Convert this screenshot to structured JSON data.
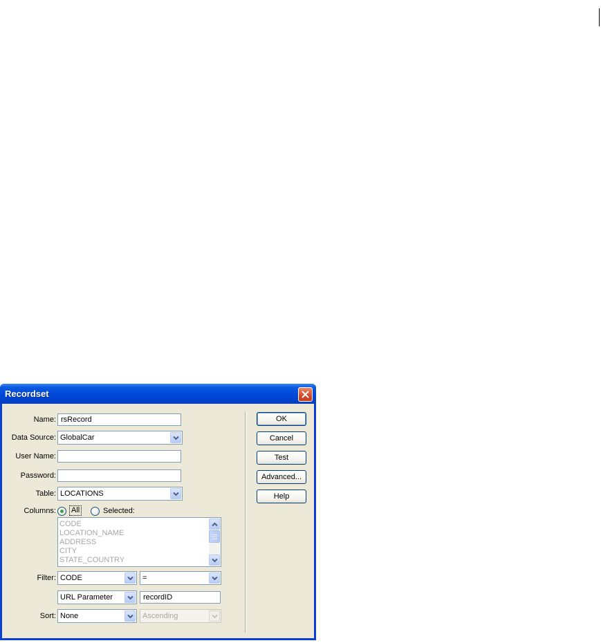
{
  "dialog": {
    "title": "Recordset",
    "close_icon": "close-icon"
  },
  "form": {
    "name": {
      "label": "Name:",
      "value": "rsRecord"
    },
    "data_source": {
      "label": "Data Source:",
      "value": "GlobalCar"
    },
    "user_name": {
      "label": "User Name:",
      "value": ""
    },
    "password": {
      "label": "Password:",
      "value": ""
    },
    "table": {
      "label": "Table:",
      "value": "LOCATIONS"
    },
    "columns": {
      "label": "Columns:",
      "option_all": "All",
      "option_selected": "Selected:",
      "selected_option": "All",
      "items": [
        "CODE",
        "LOCATION_NAME",
        "ADDRESS",
        "CITY",
        "STATE_COUNTRY"
      ]
    },
    "filter": {
      "label": "Filter:",
      "column": "CODE",
      "operator": "=",
      "source": "URL Parameter",
      "parameter": "recordID"
    },
    "sort": {
      "label": "Sort:",
      "column": "None",
      "order": "Ascending"
    }
  },
  "buttons": {
    "ok": "OK",
    "cancel": "Cancel",
    "test": "Test",
    "advanced": "Advanced...",
    "help": "Help"
  },
  "colors": {
    "titlebar": "#0048d8",
    "client_bg": "#ece9d8",
    "close_button": "#d3492a",
    "input_border": "#7f9db9"
  }
}
